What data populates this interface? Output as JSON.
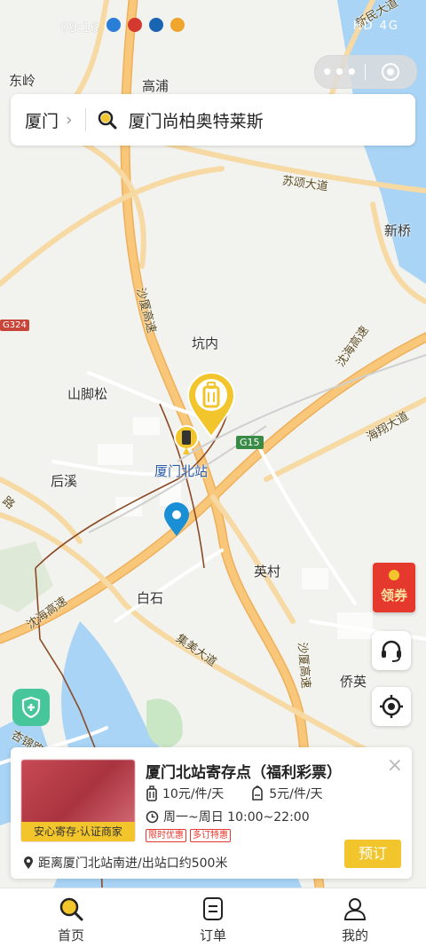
{
  "status": {
    "time": "09:16",
    "signal": "HD 4G"
  },
  "capsule": {
    "more": "•••",
    "close_icon": "target-circle-icon"
  },
  "search": {
    "city": "厦门",
    "query": "厦门尚柏奥特莱斯"
  },
  "map": {
    "labels": {
      "donglin": "东岭",
      "gaopu": "高浦",
      "xinqiao": "新桥",
      "kengnei": "坑内",
      "shanjiaosong": "山脚松",
      "houxi": "后溪",
      "station": "厦门北站",
      "yingcun": "英村",
      "baishi": "白石",
      "qiaoying": "侨英",
      "xinmin": "新民大道",
      "suxing": "苏颂大道",
      "shahai_exp": "沈海高速",
      "shaxia_exp": "沙厦高速",
      "haixiang": "海翔大道",
      "jimei": "集美大道",
      "shahai_exp2": "沈海高速",
      "shaxia_exp2": "沙厦高速",
      "xinglin_road": "路",
      "gongyinglu": "杏锦路"
    },
    "badges": {
      "g324": "G324",
      "g15": "G15"
    },
    "colors": {
      "water": "#a9d4f5",
      "road": "#f8c779",
      "road_edge": "#eeb05b",
      "major": "#ffffff",
      "green": "#c9e6c5",
      "pin_yellow": "#f3c52c",
      "pin_blue": "#1a8fd6"
    }
  },
  "coupon": {
    "label": "领券"
  },
  "card": {
    "title": "厦门北站寄存点（福利彩票）",
    "badge": "安心寄存·认证商家",
    "price_large": "10元/件/天",
    "price_small": "5元/件/天",
    "hours": "周一~周日 10:00~22:00",
    "tags": [
      "限时优惠",
      "多订特惠"
    ],
    "distance": "距离厦门北站南进/出站口约500米",
    "book": "预订",
    "close": "×"
  },
  "tabs": [
    {
      "label": "首页",
      "icon": "search-icon"
    },
    {
      "label": "订单",
      "icon": "order-icon"
    },
    {
      "label": "我的",
      "icon": "profile-icon"
    }
  ]
}
